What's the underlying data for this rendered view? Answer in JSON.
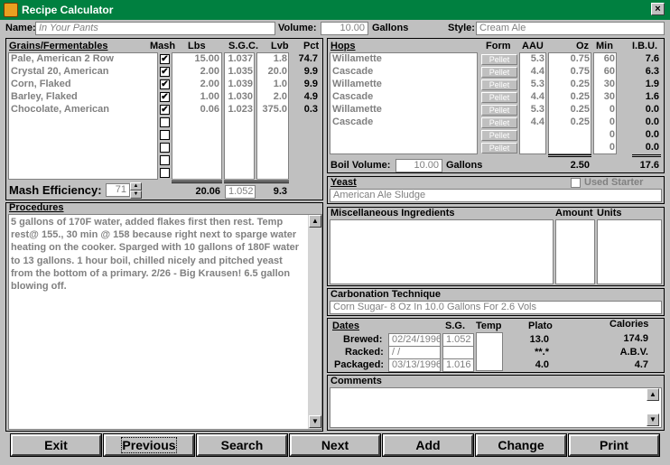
{
  "window": {
    "title": "Recipe Calculator",
    "close_glyph": "×",
    "icon": "recipe-app-icon"
  },
  "header": {
    "name_label": "Name:",
    "name_value": "In Your Pants",
    "volume_label": "Volume:",
    "volume_value": "10.00",
    "volume_unit": "Gallons",
    "style_label": "Style:",
    "style_value": "Cream Ale"
  },
  "grains": {
    "title": "Grains/Fermentables",
    "columns": {
      "mash": "Mash",
      "lbs": "Lbs",
      "sgc": "S.G.C.",
      "lvb": "Lvb",
      "pct": "Pct"
    },
    "rows": [
      {
        "name": "Pale, American 2 Row",
        "mash": "✔",
        "lbs": "15.00",
        "sgc": "1.037",
        "lvb": "1.8",
        "pct": "74.7"
      },
      {
        "name": "Crystal 20, American",
        "mash": "✔",
        "lbs": "2.00",
        "sgc": "1.035",
        "lvb": "20.0",
        "pct": "9.9"
      },
      {
        "name": "Corn, Flaked",
        "mash": "✔",
        "lbs": "2.00",
        "sgc": "1.039",
        "lvb": "1.0",
        "pct": "9.9"
      },
      {
        "name": "Barley, Flaked",
        "mash": "✔",
        "lbs": "1.00",
        "sgc": "1.030",
        "lvb": "2.0",
        "pct": "4.9"
      },
      {
        "name": "Chocolate, American",
        "mash": "✔",
        "lbs": "0.06",
        "sgc": "1.023",
        "lvb": "375.0",
        "pct": "0.3"
      }
    ],
    "empty_checks": 5,
    "mash_efficiency_label": "Mash Efficiency:",
    "mash_efficiency_value": "71",
    "total_lbs": "20.06",
    "total_sgc": "1.052",
    "total_lvb": "9.3"
  },
  "hops": {
    "title": "Hops",
    "columns": {
      "form": "Form",
      "aau": "AAU",
      "oz": "Oz",
      "min": "Min",
      "ibu": "I.B.U."
    },
    "rows": [
      {
        "name": "Willamette",
        "form": "Pellet",
        "aau": "5.3",
        "oz": "0.75",
        "min": "60",
        "ibu": "7.6"
      },
      {
        "name": "Cascade",
        "form": "Pellet",
        "aau": "4.4",
        "oz": "0.75",
        "min": "60",
        "ibu": "6.3"
      },
      {
        "name": "Willamette",
        "form": "Pellet",
        "aau": "5.3",
        "oz": "0.25",
        "min": "30",
        "ibu": "1.9"
      },
      {
        "name": "Cascade",
        "form": "Pellet",
        "aau": "4.4",
        "oz": "0.25",
        "min": "30",
        "ibu": "1.6"
      },
      {
        "name": "Willamette",
        "form": "Pellet",
        "aau": "5.3",
        "oz": "0.25",
        "min": "0",
        "ibu": "0.0"
      },
      {
        "name": "Cascade",
        "form": "Pellet",
        "aau": "4.4",
        "oz": "0.25",
        "min": "0",
        "ibu": "0.0"
      },
      {
        "name": "",
        "form": "Pellet",
        "aau": "",
        "oz": "",
        "min": "0",
        "ibu": "0.0"
      },
      {
        "name": "",
        "form": "Pellet",
        "aau": "",
        "oz": "",
        "min": "0",
        "ibu": "0.0"
      }
    ],
    "boil_volume_label": "Boil Volume:",
    "boil_volume_value": "10.00",
    "boil_volume_unit": "Gallons",
    "total_oz": "2.50",
    "total_ibu": "17.6"
  },
  "yeast": {
    "title": "Yeast",
    "used_starter_label": "Used Starter",
    "value": "American Ale Sludge"
  },
  "misc": {
    "title": "Miscellaneous Ingredients",
    "amount_label": "Amount",
    "units_label": "Units"
  },
  "carbonation": {
    "title": "Carbonation Technique",
    "value": "Corn Sugar- 8 Oz In 10.0 Gallons For 2.6 Vols"
  },
  "dates": {
    "title": "Dates",
    "sg_label": "S.G.",
    "temp_label": "Temp",
    "plato_label": "Plato",
    "calories_label": "Calories",
    "abv_label": "A.B.V.",
    "brewed_label": "Brewed:",
    "brewed_date": "02/24/1996",
    "brewed_sg": "1.052",
    "plato": "13.0",
    "calories": "174.9",
    "racked_label": "Racked:",
    "racked_date": " /  /",
    "racked_plato": "**.*",
    "packaged_label": "Packaged:",
    "packaged_date": "03/13/1996",
    "packaged_sg": "1.016",
    "packaged_plato": "4.0",
    "abv": "4.7"
  },
  "comments": {
    "title": "Comments"
  },
  "procedures": {
    "title": "Procedures",
    "text": "5 gallons of 170F water, added flakes first then rest. Temp rest@ 155., 30 min @ 158 because right next to sparge water heating on the cooker. Sparged with 10 gallons of 180F water to 13 gallons. 1 hour boil, chilled nicely and pitched yeast from the bottom of a primary. 2/26 - Big Krausen! 6.5 gallon blowing off."
  },
  "buttons": {
    "exit": "Exit",
    "previous": "Previous",
    "search": "Search",
    "next": "Next",
    "add": "Add",
    "change": "Change",
    "print": "Print"
  },
  "scroll_glyphs": {
    "up": "▲",
    "down": "▼"
  }
}
